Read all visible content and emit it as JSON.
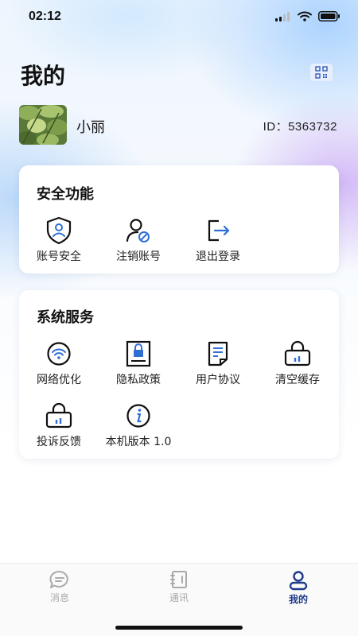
{
  "status_bar": {
    "time": "02:12"
  },
  "header": {
    "title": "我的"
  },
  "profile": {
    "username": "小丽",
    "id_text": "ID：5363732"
  },
  "security": {
    "title": "安全功能",
    "items": [
      {
        "label": "账号安全",
        "icon": "shield-user-icon"
      },
      {
        "label": "注销账号",
        "icon": "user-cancel-icon"
      },
      {
        "label": "退出登录",
        "icon": "logout-icon"
      }
    ]
  },
  "services": {
    "title": "系统服务",
    "items": [
      {
        "label": "网络优化",
        "icon": "wifi-icon"
      },
      {
        "label": "隐私政策",
        "icon": "privacy-lock-icon"
      },
      {
        "label": "用户协议",
        "icon": "agreement-document-icon"
      },
      {
        "label": "清空缓存",
        "icon": "bag-icon"
      },
      {
        "label": "投诉反馈",
        "icon": "bag-icon"
      },
      {
        "label": "本机版本 1.0",
        "icon": "info-icon"
      }
    ]
  },
  "tabbar": {
    "items": [
      {
        "label": "消息",
        "icon": "chat-icon",
        "active": false
      },
      {
        "label": "通讯",
        "icon": "contacts-book-icon",
        "active": false
      },
      {
        "label": "我的",
        "icon": "profile-icon",
        "active": true
      }
    ]
  },
  "colors": {
    "accent": "#1e3a8a",
    "icon_blue": "#2f6fd6",
    "inactive": "#aaaaaa"
  }
}
